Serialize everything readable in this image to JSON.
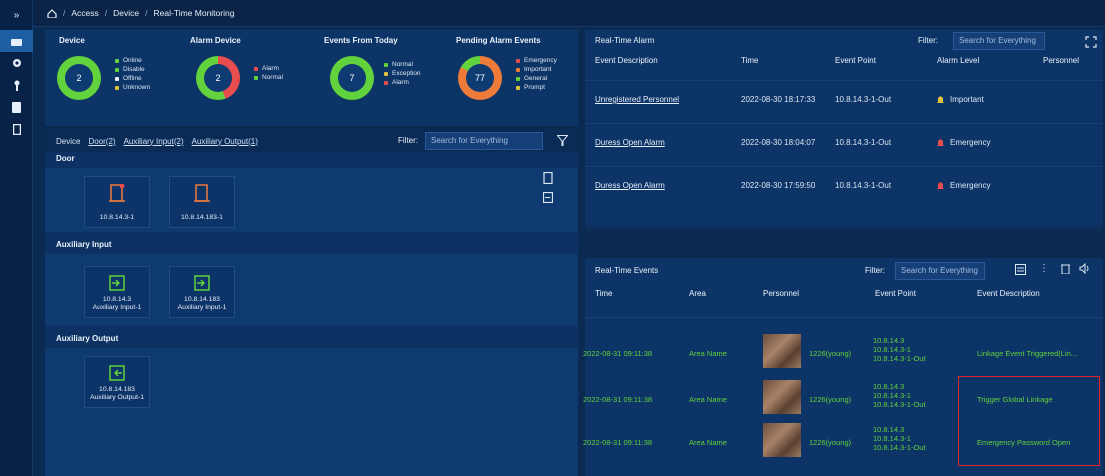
{
  "breadcrumb": [
    "Access",
    "Device",
    "Real-Time Monitoring"
  ],
  "stats": [
    {
      "title": "Device",
      "value": "2",
      "legend": [
        "Online",
        "Disable",
        "Offline",
        "Unknown"
      ],
      "legend_colors": [
        "#62d23d",
        "#62d23d",
        "#e6eefa",
        "#e0c33a"
      ]
    },
    {
      "title": "Alarm Device",
      "value": "2",
      "legend": [
        "Alarm",
        "Normal"
      ],
      "legend_colors": [
        "#ea4d4d",
        "#62d23d"
      ]
    },
    {
      "title": "Events From Today",
      "value": "7",
      "legend": [
        "Normal",
        "Exception",
        "Alarm"
      ],
      "legend_colors": [
        "#62d23d",
        "#e0c33a",
        "#ea4d4d"
      ]
    },
    {
      "title": "Pending Alarm Events",
      "value": "77",
      "legend": [
        "Emergency",
        "Important",
        "General",
        "Prompt"
      ],
      "legend_colors": [
        "#ea4d4d",
        "#ee7b3a",
        "#62d23d",
        "#e0c33a"
      ]
    }
  ],
  "device_tabs": {
    "device": "Device",
    "door": "Door(2)",
    "aux_in": "Auxiliary Input(2)",
    "aux_out": "Auxiliary Output(1)"
  },
  "filter_label": "Filter:",
  "search_placeholder": "Search for Everything",
  "sections": {
    "door": "Door",
    "aux_input": "Auxiliary Input",
    "aux_output": "Auxiliary Output"
  },
  "doors": [
    "10.8.14.3-1",
    "10.8.14.183-1"
  ],
  "aux_inputs": [
    {
      "ip": "10.8.14.3",
      "name": "Auxiliary Input-1"
    },
    {
      "ip": "10.8.14.183",
      "name": "Auxiliary Input-1"
    }
  ],
  "aux_outputs": [
    {
      "ip": "10.8.14.183",
      "name": "Auxiliary Output-1"
    }
  ],
  "alarm": {
    "title": "Real-Time Alarm",
    "columns": [
      "Event Description",
      "Time",
      "Event Point",
      "Alarm Level",
      "Personnel"
    ],
    "rows": [
      {
        "desc": "Unregistered Personnel",
        "time": "2022-08-30 18:17:33",
        "point": "10.8.14.3-1-Out",
        "level": "Important",
        "level_color": "#e0c33a"
      },
      {
        "desc": "Duress Open Alarm",
        "time": "2022-08-30 18:04:07",
        "point": "10.8.14.3-1-Out",
        "level": "Emergency",
        "level_color": "#ea4d4d"
      },
      {
        "desc": "Duress Open Alarm",
        "time": "2022-08-30 17:59:50",
        "point": "10.8.14.3-1-Out",
        "level": "Emergency",
        "level_color": "#ea4d4d"
      }
    ]
  },
  "events": {
    "title": "Real-Time Events",
    "columns": [
      "Time",
      "Area",
      "Personnel",
      "Event Point",
      "Event Description"
    ],
    "rows": [
      {
        "time": "2022-08-31 09:11:38",
        "area": "Area Name",
        "person": "1226(young)",
        "point": [
          "10.8.14.3",
          "10.8.14.3-1",
          "10.8.14.3-1-Out"
        ],
        "desc": "Linkage Event Triggered(Lin..."
      },
      {
        "time": "2022-08-31 09:11:38",
        "area": "Area Name",
        "person": "1226(young)",
        "point": [
          "10.8.14.3",
          "10.8.14.3-1",
          "10.8.14.3-1-Out"
        ],
        "desc": "Trigger Global Linkage"
      },
      {
        "time": "2022-08-31 09:11:38",
        "area": "Area Name",
        "person": "1226(young)",
        "point": [
          "10.8.14.3",
          "10.8.14.3-1",
          "10.8.14.3-1-Out"
        ],
        "desc": "Emergency Password Open"
      }
    ]
  }
}
